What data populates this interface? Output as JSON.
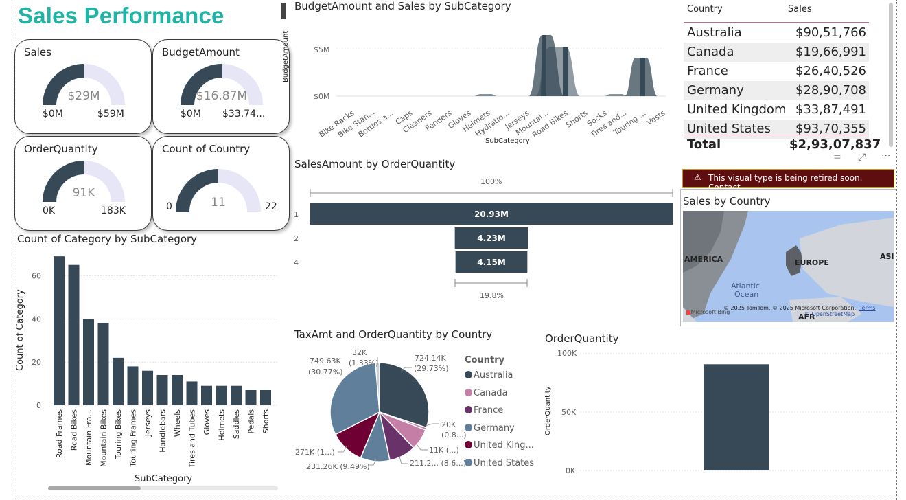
{
  "page_title": "Sales Performance",
  "colors": {
    "accent": "#21b3a5",
    "dark": "#374957",
    "light": "#e6e6f7",
    "warning_bg": "#5e0e0e"
  },
  "kpi_cards": [
    {
      "title": "Sales",
      "value": "$29M",
      "min": "$0M",
      "max": "$59M",
      "fraction": 0.5
    },
    {
      "title": "BudgetAmount",
      "value": "$16.87M",
      "min": "$0M",
      "max": "$33.74...",
      "fraction": 0.5
    },
    {
      "title": "OrderQuantity",
      "value": "91K",
      "min": "0K",
      "max": "183K",
      "fraction": 0.5
    },
    {
      "title": "Count of Country",
      "value": "11",
      "min": "0",
      "max": "22",
      "fraction": 0.5
    }
  ],
  "budget_chart": {
    "title": "BudgetAmount and Sales by SubCategory",
    "xlabel": "SubCategory",
    "ylabel": "BudgetAmount",
    "yticks": [
      "$5M",
      "$0M"
    ],
    "categories": [
      "Bike Racks",
      "Bike Stan...",
      "Bottles a...",
      "Caps",
      "Cleaners",
      "Fenders",
      "Gloves",
      "Helmets",
      "Hydratio...",
      "Jerseys",
      "Mountai...",
      "Road Bikes",
      "Shorts",
      "Socks",
      "Tires and...",
      "Touring ...",
      "Vests"
    ]
  },
  "country_table": {
    "headers": [
      "Country",
      "Sales"
    ],
    "rows": [
      {
        "country": "Australia",
        "sales": "$90,51,766"
      },
      {
        "country": "Canada",
        "sales": "$19,66,991"
      },
      {
        "country": "France",
        "sales": "$26,40,526"
      },
      {
        "country": "Germany",
        "sales": "$28,90,708"
      },
      {
        "country": "United Kingdom",
        "sales": "$33,87,491"
      },
      {
        "country": "United States",
        "sales": "$93,70,355"
      }
    ],
    "total_label": "Total",
    "total_value": "$2,93,07,837"
  },
  "warning_text": "This visual type is being retired soon. Contact...",
  "map": {
    "title": "Sales by Country",
    "labels": {
      "america": "AMERICA",
      "europe": "EUROPE",
      "asia": "ASI",
      "ocean1": "Atlantic",
      "ocean2": "Ocean",
      "afr": "AFR"
    },
    "attribution": "© 2025 TomTom, © 2025 Microsoft Corporation,",
    "terms": "Terms",
    "osm": "© OpenStreetMap",
    "bing": "Microsoft Bing"
  },
  "funnel": {
    "title": "SalesAmount by OrderQuantity",
    "top_label": "100%",
    "bottom_label": "19.8%"
  },
  "category_chart": {
    "title": "Count of Category by SubCategory",
    "xlabel": "SubCategory",
    "ylabel": "Count of Category"
  },
  "pie": {
    "title": "TaxAmt and OrderQuantity by Country",
    "legend_title": "Country",
    "slice_labels": [
      "724.14K",
      "(29.73%)",
      "20K",
      "(0.8...)",
      "11K (...)",
      "211.2... (8.6...)",
      "231.26K (9.49%)",
      "271K (1...)",
      "749.63K",
      "(30.77%)",
      "32K",
      "(1.33%)"
    ]
  },
  "order_chart": {
    "title": "OrderQuantity",
    "ylabel": "OrderQuantity",
    "yticks": [
      "100K",
      "50K",
      "0K"
    ]
  },
  "chart_data": [
    {
      "type": "bar",
      "title": "Count of Category by SubCategory",
      "xlabel": "SubCategory",
      "ylabel": "Count of Category",
      "categories": [
        "Road Frames",
        "Road Bikes",
        "Mountain Fra...",
        "Mountain Bikes",
        "Touring Bikes",
        "Touring Frames",
        "Jerseys",
        "Handlebars",
        "Wheels",
        "Tires and Tubes",
        "Gloves",
        "Helmets",
        "Saddles",
        "Pedals",
        "Shorts"
      ],
      "values": [
        69,
        65,
        40,
        38,
        22,
        18,
        16,
        14,
        14,
        11,
        9,
        9,
        9,
        7,
        7
      ],
      "ylim": [
        0,
        70
      ],
      "yticks": [
        0,
        20,
        40,
        60
      ]
    },
    {
      "type": "bar",
      "title": "SalesAmount by OrderQuantity",
      "categories": [
        "1",
        "2",
        "4"
      ],
      "values": [
        20.93,
        4.23,
        4.15
      ],
      "value_labels": [
        "20.93M",
        "4.23M",
        "4.15M"
      ]
    },
    {
      "type": "pie",
      "title": "TaxAmt and OrderQuantity by Country",
      "categories": [
        "Australia",
        "Canada",
        "France",
        "Germany",
        "United Kingdom",
        "United States"
      ],
      "values": [
        724.14,
        20,
        11,
        211.2,
        231.26,
        271,
        749.63,
        32
      ],
      "series": [
        {
          "name": "Country",
          "values": [
            29.73,
            0.8,
            0.45,
            8.67,
            9.49,
            11.13,
            30.77,
            1.33
          ]
        }
      ],
      "legend": [
        "Australia",
        "Canada",
        "France",
        "Germany",
        "United King...",
        "United States"
      ]
    },
    {
      "type": "bar",
      "title": "OrderQuantity",
      "ylabel": "OrderQuantity",
      "values": [
        91
      ],
      "ylim": [
        0,
        100
      ]
    }
  ]
}
